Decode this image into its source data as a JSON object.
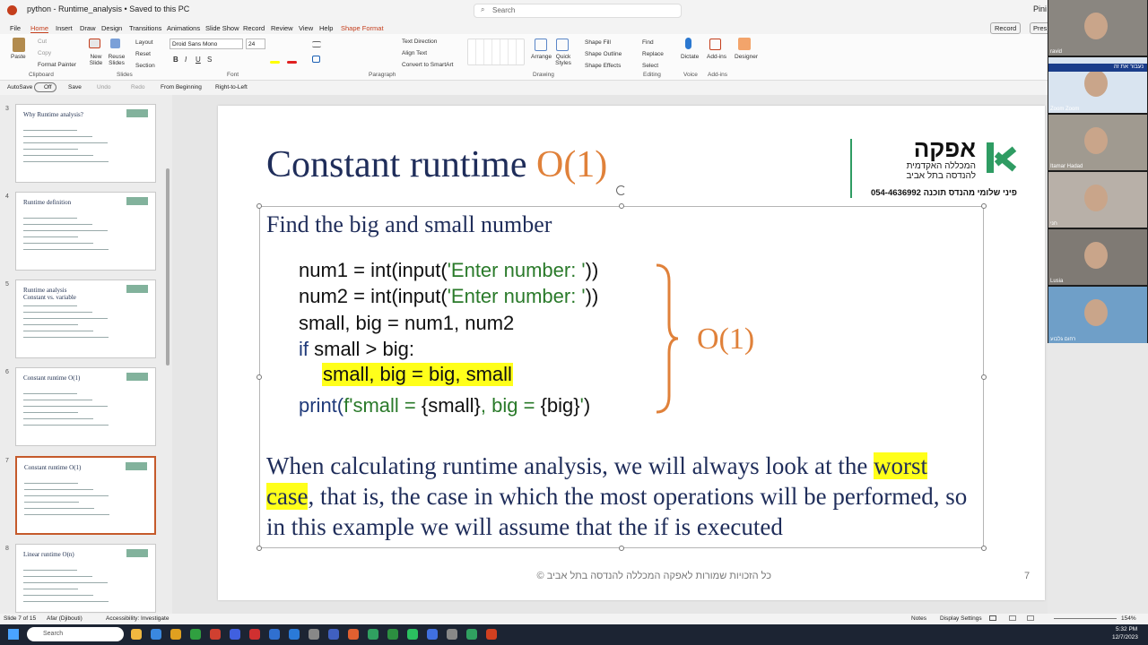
{
  "titlebar": {
    "file_title": "python - Runtime_analysis • Saved to this PC",
    "search_placeholder": "Search",
    "user": "Pini T"
  },
  "menu": [
    "File",
    "Home",
    "Insert",
    "Draw",
    "Design",
    "Transitions",
    "Animations",
    "Slide Show",
    "Record",
    "Review",
    "View",
    "Help",
    "Shape Format"
  ],
  "menu_right": {
    "record": "Record",
    "present": "Pres"
  },
  "ribbon": {
    "paste": "Paste",
    "clip_items": [
      "Cut",
      "Copy",
      "Format Painter"
    ],
    "new_slide": "New Slide",
    "reuse": "Reuse Slides",
    "slide_items": [
      "Layout",
      "Reset",
      "Section"
    ],
    "font_name": "Droid Sans Mono",
    "font_size": "24",
    "text_items": [
      "Text Direction",
      "Align Text",
      "Convert to SmartArt"
    ],
    "arrange": "Arrange",
    "quick_styles": "Quick Styles",
    "shape_items": [
      "Shape Fill",
      "Shape Outline",
      "Shape Effects"
    ],
    "edit_items": [
      "Find",
      "Replace",
      "Select"
    ],
    "dictate": "Dictate",
    "addins": "Add-ins",
    "designer": "Designer",
    "groups": [
      "Clipboard",
      "Slides",
      "Font",
      "Paragraph",
      "Drawing",
      "Editing",
      "Voice",
      "Add-ins"
    ]
  },
  "qat": {
    "autosave": "AutoSave",
    "toggle": "Off",
    "save": "Save",
    "undo": "Undo",
    "redo": "Redo",
    "from_beginning": "From Beginning",
    "rtl": "Right-to-Left"
  },
  "thumbnails": [
    {
      "num": "3",
      "title": "Why Runtime analysis?"
    },
    {
      "num": "4",
      "title": "Runtime definition"
    },
    {
      "num": "5",
      "title": "Runtime analysis\nConstant vs. variable"
    },
    {
      "num": "6",
      "title": "Constant runtime O(1)"
    },
    {
      "num": "7",
      "title": "Constant runtime O(1)"
    },
    {
      "num": "8",
      "title": "Linear runtime O(n)"
    }
  ],
  "slide": {
    "title": "Constant runtime ",
    "title_o": "O(1)",
    "logo_heb": "אפקה",
    "logo_sub1": "המכללה האקדמית",
    "logo_sub2": "להנדסה בתל אביב",
    "logo_contact": "פיני שלומי מהנדס תוכנה 054-4636992",
    "subtitle": "Find the big and small number",
    "code": {
      "l1a": "num1 = int(input(",
      "l1b": "'Enter number: '",
      "l1c": "))",
      "l2a": "num2 = int(input(",
      "l2b": "'Enter number: '",
      "l2c": "))",
      "l3": "small, big =  num1, num2",
      "l4a": "if",
      "l4b": " small > big:",
      "l5": "small, big = big, small",
      "l6a": "print(",
      "l6b": "f'small = ",
      "l6c": "{small}",
      "l6d": ", big = ",
      "l6e": "{big}",
      "l6f": "'",
      "l6g": ")"
    },
    "brace_label": "O(1)",
    "para_a": "When calculating runtime analysis, we will always look at the ",
    "para_hl1": "worst",
    "para_hl2": "case",
    "para_b": ", that is, the case in which the most operations will be performed, so in this example we will assume that the if is executed",
    "footer": "© כל הזכויות שמורות לאפקה המכללה להנדסה בתל אביב",
    "page": "7"
  },
  "status": {
    "slide_of": "Slide 7 of 15",
    "lang": "Afar (Djibouti)",
    "access": "Accessibility: Investigate",
    "notes": "Notes",
    "display": "Display Settings",
    "zoom": "154%"
  },
  "taskbar": {
    "search": "Search",
    "time": "5:32 PM",
    "date": "12/7/2023"
  },
  "video": [
    {
      "name": "ravid"
    },
    {
      "name": "Zoom Zoom",
      "banner": "נעבור את זה"
    },
    {
      "name": "Itamar Hadad"
    },
    {
      "name": "חני"
    },
    {
      "name": "Lusia"
    },
    {
      "name": "רחום גלבוע"
    }
  ],
  "colors": {
    "accent": "#c43e1c",
    "orange": "#e0813a",
    "navy": "#1f2d5a",
    "highlight": "#ffff1a"
  }
}
